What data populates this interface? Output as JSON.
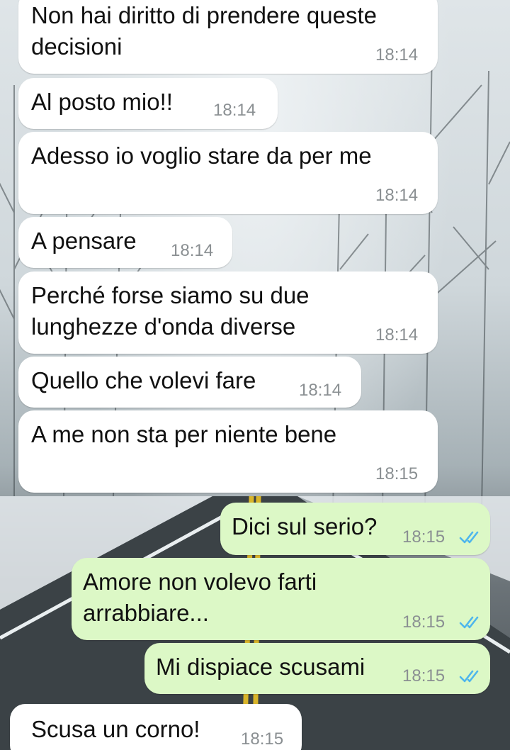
{
  "messages": [
    {
      "direction": "incoming",
      "text": "Non hai diritto di prendere queste\ndecisioni",
      "time": "18:14"
    },
    {
      "direction": "incoming",
      "text": "Al posto mio!!",
      "time": "18:14"
    },
    {
      "direction": "incoming",
      "text": "Adesso io voglio stare da per me",
      "time": "18:14"
    },
    {
      "direction": "incoming",
      "text": "A pensare",
      "time": "18:14"
    },
    {
      "direction": "incoming",
      "text": "Perché forse siamo su due\nlunghezze d'onda diverse",
      "time": "18:14"
    },
    {
      "direction": "incoming",
      "text": "Quello che volevi fare",
      "time": "18:14"
    },
    {
      "direction": "incoming",
      "text": "A me non sta per niente bene",
      "time": "18:15"
    },
    {
      "direction": "outgoing",
      "text": "Dici sul serio?",
      "time": "18:15",
      "status": "read"
    },
    {
      "direction": "outgoing",
      "text": "Amore non volevo farti\narrabbiare...",
      "time": "18:15",
      "status": "read"
    },
    {
      "direction": "outgoing",
      "text": "Mi dispiace scusami",
      "time": "18:15",
      "status": "read"
    },
    {
      "direction": "incoming",
      "text": "Scusa un corno!",
      "time": "18:15"
    }
  ],
  "colors": {
    "incoming_bubble": "#ffffff",
    "outgoing_bubble": "#dcf8c6",
    "read_ticks": "#4fb6ec",
    "timestamp": "#8a8f92"
  },
  "icons": {
    "read_status": "double-check-icon",
    "background": "snowy-forest-road-wallpaper"
  }
}
